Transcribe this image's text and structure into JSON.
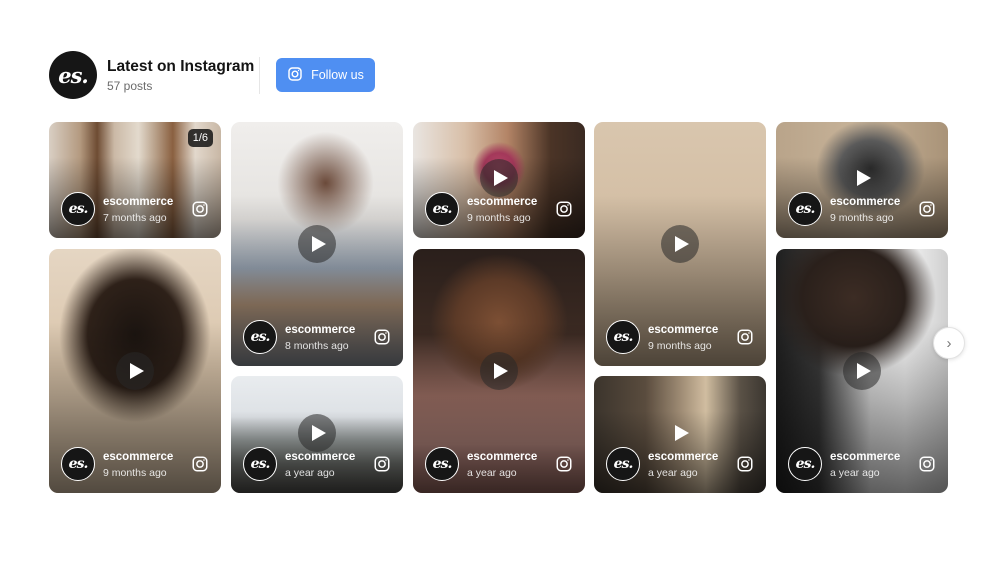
{
  "header": {
    "logo_text": "es.",
    "title": "Latest on Instagram",
    "subtitle": "57 posts",
    "follow_label": "Follow us"
  },
  "posts": [
    {
      "user": "escommerce",
      "time": "7 months ago",
      "avatar": "es.",
      "badge": "1/6",
      "video": false
    },
    {
      "user": "escommerce",
      "time": "9 months ago",
      "avatar": "es.",
      "video": true
    },
    {
      "user": "escommerce",
      "time": "8 months ago",
      "avatar": "es.",
      "video": true
    },
    {
      "user": "escommerce",
      "time": "a year ago",
      "avatar": "es.",
      "video": true
    },
    {
      "user": "escommerce",
      "time": "9 months ago",
      "avatar": "es.",
      "video": true
    },
    {
      "user": "escommerce",
      "time": "a year ago",
      "avatar": "es.",
      "video": true
    },
    {
      "user": "escommerce",
      "time": "9 months ago",
      "avatar": "es.",
      "video": true
    },
    {
      "user": "escommerce",
      "time": "a year ago",
      "avatar": "es.",
      "video": true
    },
    {
      "user": "escommerce",
      "time": "9 months ago",
      "avatar": "es.",
      "video": true
    },
    {
      "user": "escommerce",
      "time": "a year ago",
      "avatar": "es.",
      "video": true
    }
  ],
  "navigation": {
    "next_label": "›"
  },
  "colors": {
    "accent": "#4f8ff2",
    "logo_bg": "#161616"
  }
}
